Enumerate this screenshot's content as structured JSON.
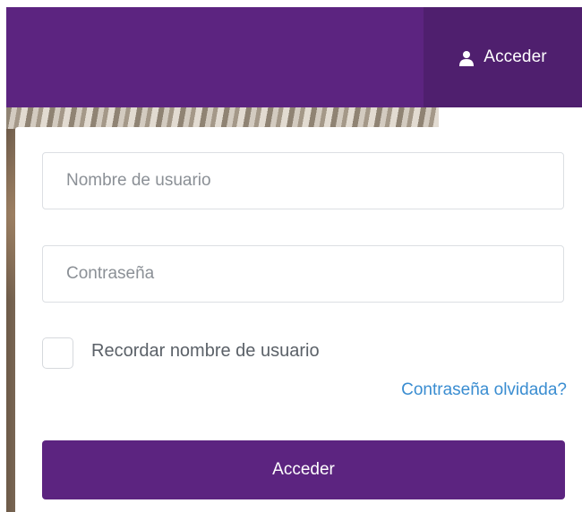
{
  "header": {
    "login_label": "Acceder",
    "login_icon": "user-icon",
    "bar_color": "#5c2480",
    "login_bg_color": "#4f1f6e"
  },
  "form": {
    "username": {
      "value": "",
      "placeholder": "Nombre de usuario"
    },
    "password": {
      "value": "",
      "placeholder": "Contraseña"
    },
    "remember": {
      "label": "Recordar nombre de usuario",
      "checked": false
    },
    "forgot_label": "Contraseña olvidada?",
    "submit_label": "Acceder",
    "link_color": "#3a8dd1"
  }
}
